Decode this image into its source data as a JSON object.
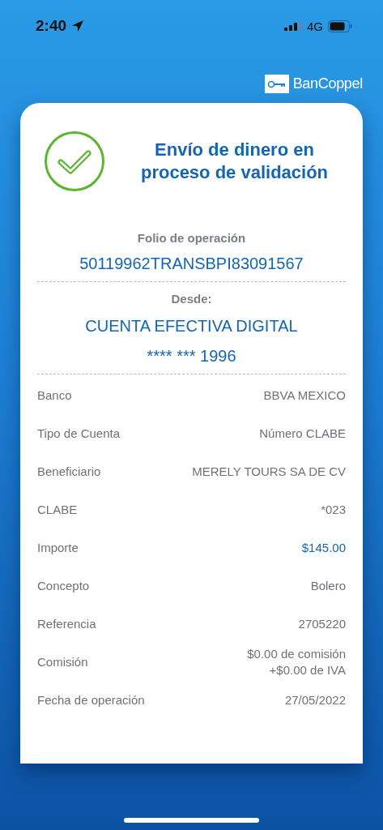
{
  "status_bar": {
    "time": "2:40",
    "network": "4G"
  },
  "brand": {
    "name": "BanCoppel"
  },
  "receipt": {
    "title": "Envío de dinero en proceso de validación",
    "folio": {
      "label": "Folio de operación",
      "value": "50119962TRANSBPI83091567"
    },
    "source": {
      "label": "Desde:",
      "account_name": "CUENTA EFECTIVA DIGITAL",
      "account_number": "**** *** 1996"
    },
    "details": [
      {
        "label": "Banco",
        "value": [
          "BBVA MEXICO"
        ],
        "kind": "plain"
      },
      {
        "label": "Tipo de Cuenta",
        "value": [
          "Número CLABE"
        ],
        "kind": "plain"
      },
      {
        "label": "Beneficiario",
        "value": [
          "MERELY TOURS SA DE CV"
        ],
        "kind": "plain"
      },
      {
        "label": "CLABE",
        "value": [
          "*023"
        ],
        "kind": "plain"
      },
      {
        "label": "Importe",
        "value": [
          "$145.00"
        ],
        "kind": "amount"
      },
      {
        "label": "Concepto",
        "value": [
          "Bolero"
        ],
        "kind": "plain"
      },
      {
        "label": "Referencia",
        "value": [
          "2705220"
        ],
        "kind": "plain"
      },
      {
        "label": "Comisión",
        "value": [
          "$0.00 de comisión",
          "+$0.00 de IVA"
        ],
        "kind": "plain"
      },
      {
        "label": "Fecha de operación",
        "value": [
          "27/05/2022"
        ],
        "kind": "plain"
      }
    ]
  }
}
